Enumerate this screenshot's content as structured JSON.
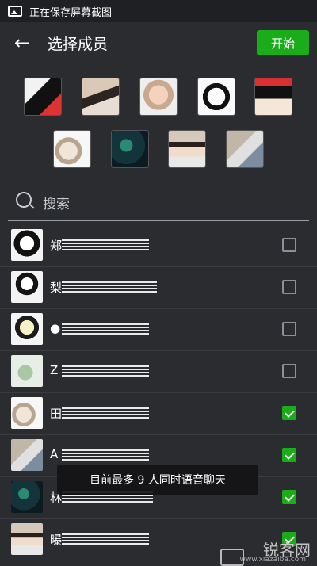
{
  "status": {
    "text": "正在保存屏幕截图"
  },
  "header": {
    "title": "选择成员",
    "start_label": "开始"
  },
  "search": {
    "placeholder": "搜索"
  },
  "contacts": [
    {
      "first_char": "郑",
      "checked": false
    },
    {
      "first_char": "梨",
      "checked": false
    },
    {
      "first_char": "●",
      "checked": false
    },
    {
      "first_char": "Z",
      "checked": false
    },
    {
      "first_char": "田",
      "checked": true
    },
    {
      "first_char": "A",
      "checked": true
    },
    {
      "first_char": "林",
      "checked": true
    },
    {
      "first_char": "曝",
      "checked": true
    }
  ],
  "toast": {
    "text": "目前最多 9 人同时语音聊天"
  },
  "watermark": {
    "main": "锐客网",
    "sub": "www.xiazaiba.com"
  }
}
